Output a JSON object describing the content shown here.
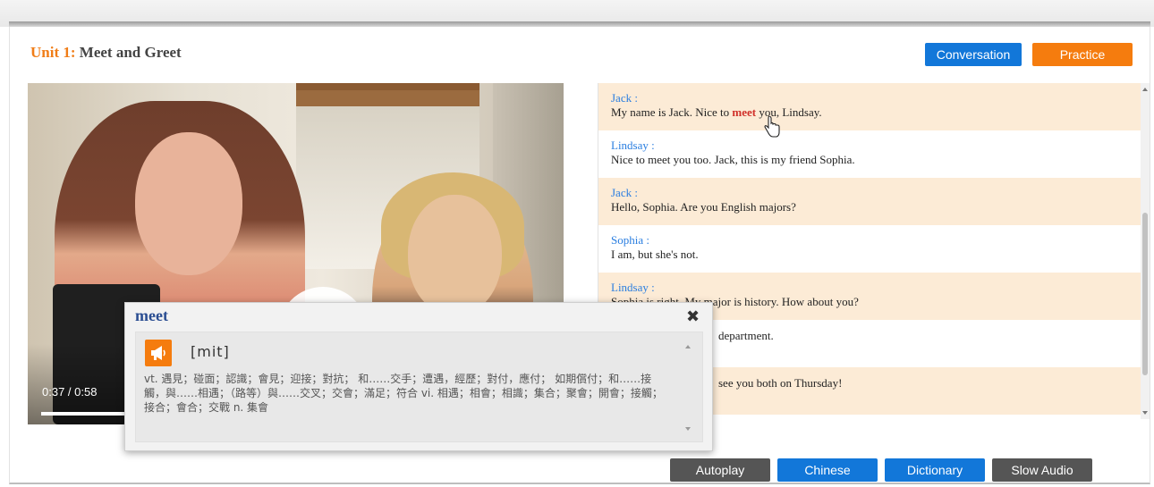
{
  "header": {
    "unit_number": "Unit 1:",
    "unit_name": "Meet and Greet",
    "tabs": [
      {
        "label": "Conversation",
        "color": "#1277d9"
      },
      {
        "label": "Practice",
        "color": "#f57c0e"
      }
    ]
  },
  "video": {
    "time_display": "0:37 / 0:58",
    "progress": 0.638
  },
  "conversation": [
    {
      "speaker": "Jack :",
      "before": "My name is Jack. Nice to ",
      "highlight": "meet",
      "after": " you, Lindsay."
    },
    {
      "speaker": "Lindsay :",
      "text": "Nice to meet you too. Jack, this is my friend Sophia."
    },
    {
      "speaker": "Jack :",
      "text": "Hello, Sophia. Are you English majors?"
    },
    {
      "speaker": "Sophia :",
      "text": "I am, but she's not."
    },
    {
      "speaker": "Lindsay :",
      "text": "Sophia is right. My major is history. How about you?"
    },
    {
      "speaker": "",
      "text": "department."
    },
    {
      "speaker": "",
      "text": "see you both on Thursday!"
    }
  ],
  "dictionary": {
    "word": "meet",
    "phonetic": "[mit]",
    "definition": "vt. 遇見；碰面；認識；會見；迎接；對抗； 和……交手；遭遇，經歷；對付，應付； 如期償付；和……接觸，與……相遇；（路等）與……交叉；交會；滿足；符合 vi. 相遇；相會；相識；集合；聚會；開會；接觸； 接合；會合；交戰 n. 集會",
    "close_icon": "close-icon",
    "speaker_icon": "megaphone-icon"
  },
  "bottom_buttons": [
    {
      "label": "Autoplay"
    },
    {
      "label": "Chinese"
    },
    {
      "label": "Dictionary"
    },
    {
      "label": "Slow Audio"
    }
  ]
}
